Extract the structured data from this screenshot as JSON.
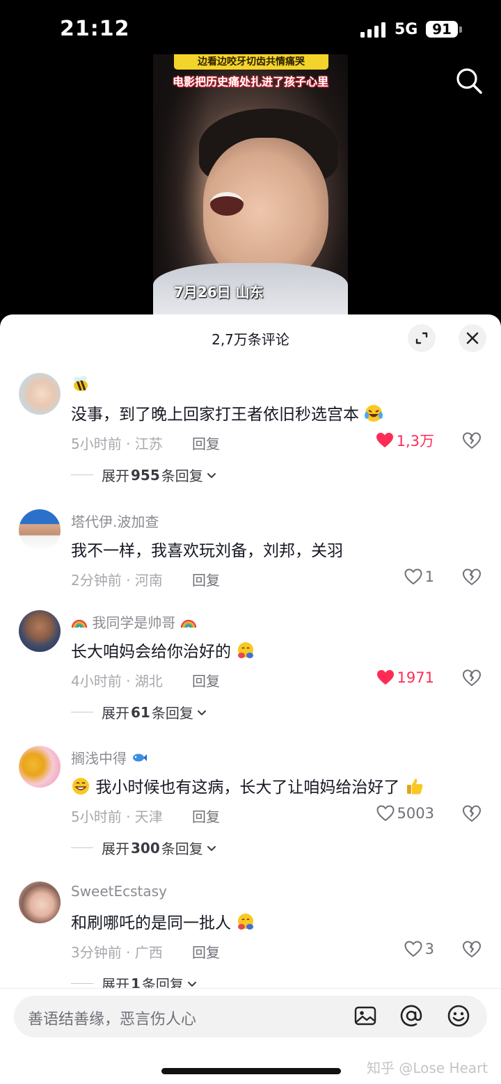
{
  "status_bar": {
    "time": "21:12",
    "network": "5G",
    "battery": "91"
  },
  "video": {
    "banner_top": "边看边咬牙切齿共情痛哭",
    "banner_main": "电影把历史痛处扎进了孩子心里",
    "date_location": "7月26日 山东"
  },
  "sheet": {
    "title": "2,7万条评论"
  },
  "comments": [
    {
      "username": "",
      "username_icon": "bee-emoji-icon",
      "text": "没事，到了晚上回家打王者依旧秒选宫本",
      "text_emoji": "laughing-tears-emoji-icon",
      "time_location": "5小时前 · 江苏",
      "reply_label": "回复",
      "likes": "1,3万",
      "liked": true,
      "expand_prefix": "展开",
      "expand_count": "955",
      "expand_suffix": "条回复"
    },
    {
      "username": "塔代伊.波加查",
      "text": "我不一样，我喜欢玩刘备，刘邦，关羽",
      "time_location": "2分钟前 · 河南",
      "reply_label": "回复",
      "likes": "1",
      "liked": false
    },
    {
      "username": "我同学是帅哥",
      "username_icon": "rainbow-emoji-icon",
      "text": "长大咱妈会给你治好的",
      "text_emoji": "hugging-emoji-icon",
      "time_location": "4小时前 · 湖北",
      "reply_label": "回复",
      "likes": "1971",
      "liked": true,
      "expand_prefix": "展开",
      "expand_count": "61",
      "expand_suffix": "条回复"
    },
    {
      "username": "搁浅中得",
      "username_icon": "fish-emoji-icon",
      "text": "我小时候也有这病，长大了让咱妈给治好了",
      "text_emoji": "thumbs-up-emoji-icon",
      "leading_emoji": "grinning-emoji-icon",
      "time_location": "5小时前 · 天津",
      "reply_label": "回复",
      "likes": "5003",
      "liked": false,
      "expand_prefix": "展开",
      "expand_count": "300",
      "expand_suffix": "条回复"
    },
    {
      "username": "SweetEcstasy",
      "text": "和刷哪吒的是同一批人",
      "text_emoji": "hugging-emoji-icon",
      "time_location": "3分钟前 · 广西",
      "reply_label": "回复",
      "likes": "3",
      "liked": false,
      "expand_prefix": "展开",
      "expand_count": "1",
      "expand_suffix": "条回复"
    }
  ],
  "input": {
    "placeholder": "善语结善缘，恶言伤人心"
  },
  "watermark": "知乎 @Lose Heart",
  "colors": {
    "like_red": "#fe2c55",
    "text_dark": "#161823",
    "text_grey": "#a7a8ad"
  }
}
